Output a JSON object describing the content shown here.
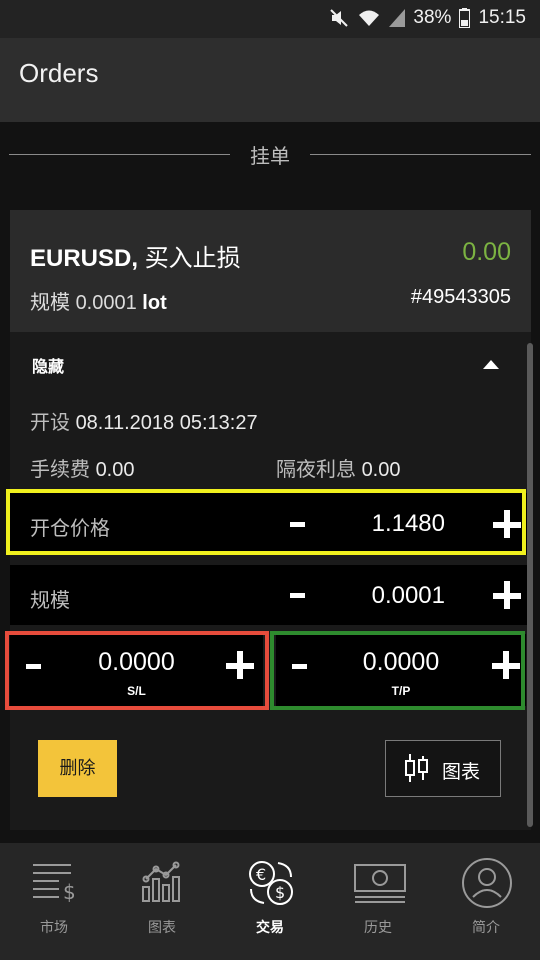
{
  "status_bar": {
    "battery": "38%",
    "time": "15:15"
  },
  "app_bar": {
    "title": "Orders"
  },
  "section": {
    "label": "挂单"
  },
  "order": {
    "symbol": "EURUSD,",
    "type": "买入止损",
    "profit": "0.00",
    "volume_label": "规模",
    "volume_value": "0.0001",
    "volume_unit": "lot",
    "ticket": "#49543305",
    "details_toggle": "隐藏",
    "open_label": "开设",
    "open_time": "08.11.2018 05:13:27",
    "commission_label": "手续费",
    "commission_value": "0.00",
    "swap_label": "隔夜利息",
    "swap_value": "0.00",
    "price_label": "开仓价格",
    "price_value": "1.1480",
    "size_label": "规模",
    "size_value": "0.0001",
    "sl_value": "0.0000",
    "sl_caption": "S/L",
    "tp_value": "0.0000",
    "tp_caption": "T/P",
    "delete_label": "删除",
    "chart_label": "图表"
  },
  "colors": {
    "profit": "#7cb342",
    "delete_button": "#f3c43a",
    "highlight_price": "#f0f01e",
    "highlight_sl": "#e74c3c",
    "highlight_tp": "#2e8b2e"
  },
  "bottom_nav": [
    {
      "label": "市场",
      "icon": "market-icon"
    },
    {
      "label": "图表",
      "icon": "chart-icon"
    },
    {
      "label": "交易",
      "icon": "trade-icon",
      "active": true
    },
    {
      "label": "历史",
      "icon": "history-icon"
    },
    {
      "label": "简介",
      "icon": "profile-icon"
    }
  ]
}
